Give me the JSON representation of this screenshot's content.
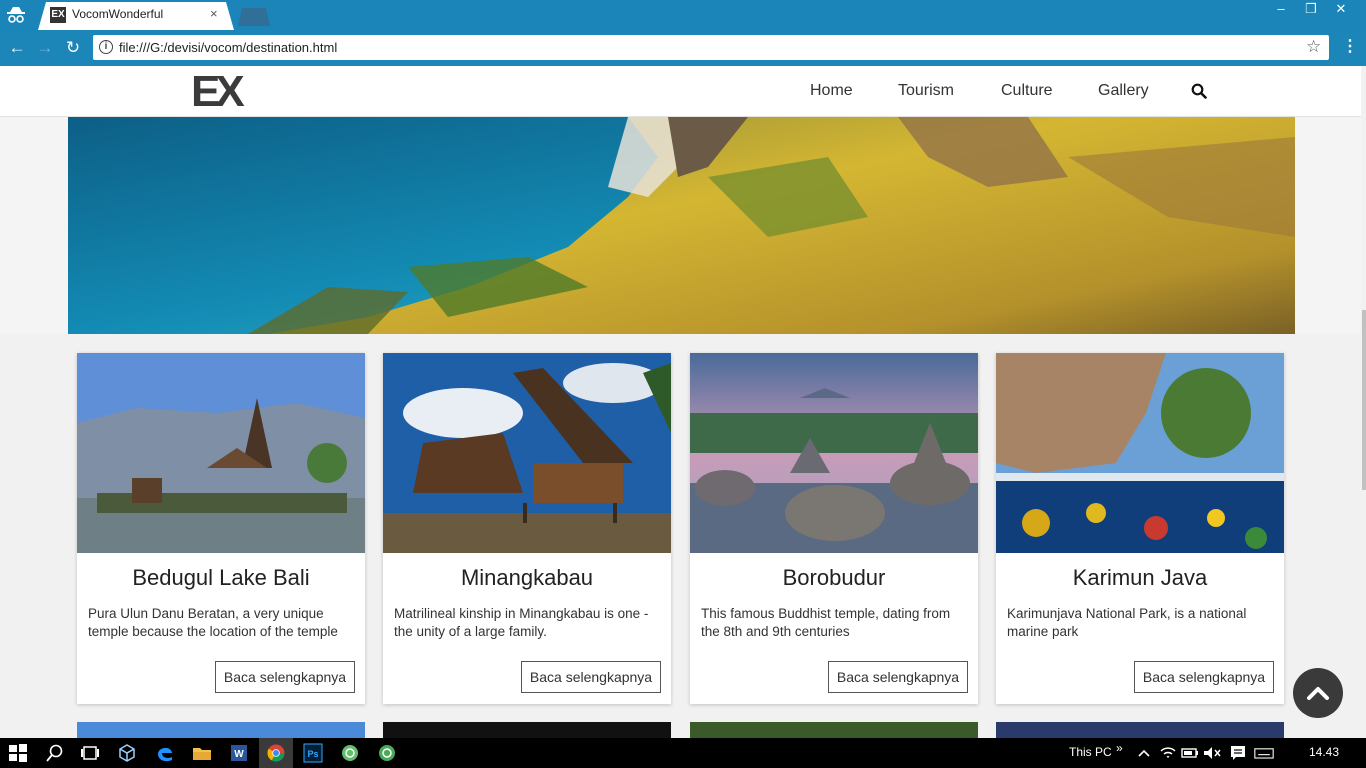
{
  "browser": {
    "tab_title": "VocomWonderful",
    "tab_favicon_text": "EX",
    "tab_close": "×",
    "url": "file:///G:/devisi/vocom/destination.html",
    "window_controls": [
      "–",
      "❐",
      "✕"
    ],
    "nav": {
      "back": "←",
      "forward": "→",
      "reload": "↻"
    },
    "star": "☆",
    "menu": "⋮"
  },
  "site": {
    "logo_text": "EX",
    "nav_items": [
      "Home",
      "Tourism",
      "Culture",
      "Gallery"
    ]
  },
  "cards": [
    {
      "title": "Bedugul Lake Bali",
      "text": "Pura Ulun Danu Beratan, a very unique temple because the location of the temple",
      "button": "Baca selengkapnya"
    },
    {
      "title": "Minangkabau",
      "text": "Matrilineal kinship in Minangkabau is one - the unity of a large family.",
      "button": "Baca selengkapnya"
    },
    {
      "title": "Borobudur",
      "text": "This famous Buddhist temple, dating from the 8th and 9th centuries",
      "button": "Baca selengkapnya"
    },
    {
      "title": "Karimun Java",
      "text": "Karimunjava National Park, is a national marine park",
      "button": "Baca selengkapnya"
    }
  ],
  "taskbar": {
    "this_pc": "This PC",
    "chevron": "»",
    "time": "14.43"
  },
  "colors": {
    "chrome_blue": "#1b84b8",
    "page_bg": "#f1f1f1",
    "back_to_top": "#3a3a3a"
  }
}
